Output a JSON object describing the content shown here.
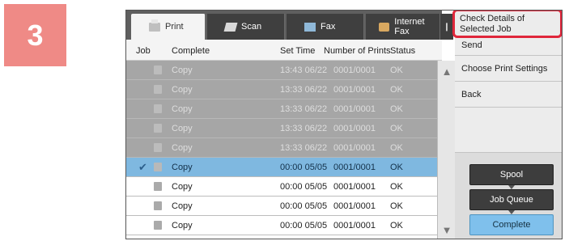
{
  "step_number": "3",
  "tabs": [
    {
      "label": "Print",
      "icon": "print-icon"
    },
    {
      "label": "Scan",
      "icon": "scan-icon"
    },
    {
      "label": "Fax",
      "icon": "fax-icon"
    },
    {
      "label": "Internet Fax",
      "icon": "internet-fax-icon"
    }
  ],
  "table": {
    "headers": {
      "job": "Job",
      "complete": "Complete",
      "set_time": "Set Time",
      "num_prints": "Number of Prints",
      "status": "Status"
    },
    "rows": [
      {
        "name": "Copy",
        "time": "13:43 06/22",
        "prints": "0001/0001",
        "status": "OK"
      },
      {
        "name": "Copy",
        "time": "13:33 06/22",
        "prints": "0001/0001",
        "status": "OK"
      },
      {
        "name": "Copy",
        "time": "13:33 06/22",
        "prints": "0001/0001",
        "status": "OK"
      },
      {
        "name": "Copy",
        "time": "13:33 06/22",
        "prints": "0001/0001",
        "status": "OK"
      },
      {
        "name": "Copy",
        "time": "13:33 06/22",
        "prints": "0001/0001",
        "status": "OK"
      },
      {
        "name": "Copy",
        "time": "00:00 05/05",
        "prints": "0001/0001",
        "status": "OK"
      },
      {
        "name": "Copy",
        "time": "00:00 05/05",
        "prints": "0001/0001",
        "status": "OK"
      },
      {
        "name": "Copy",
        "time": "00:00 05/05",
        "prints": "0001/0001",
        "status": "OK"
      },
      {
        "name": "Copy",
        "time": "00:00 05/05",
        "prints": "0001/0001",
        "status": "OK"
      }
    ]
  },
  "menu": {
    "check_details": "Check Details of\nSelected Job",
    "send": "Send",
    "choose_settings": "Choose Print Settings",
    "back": "Back"
  },
  "mode_buttons": {
    "spool": "Spool",
    "job_queue": "Job Queue",
    "complete": "Complete"
  },
  "colors": {
    "highlight": "#e0263b",
    "selected_row": "#7fb8e0",
    "badge": "#ef8a86"
  }
}
